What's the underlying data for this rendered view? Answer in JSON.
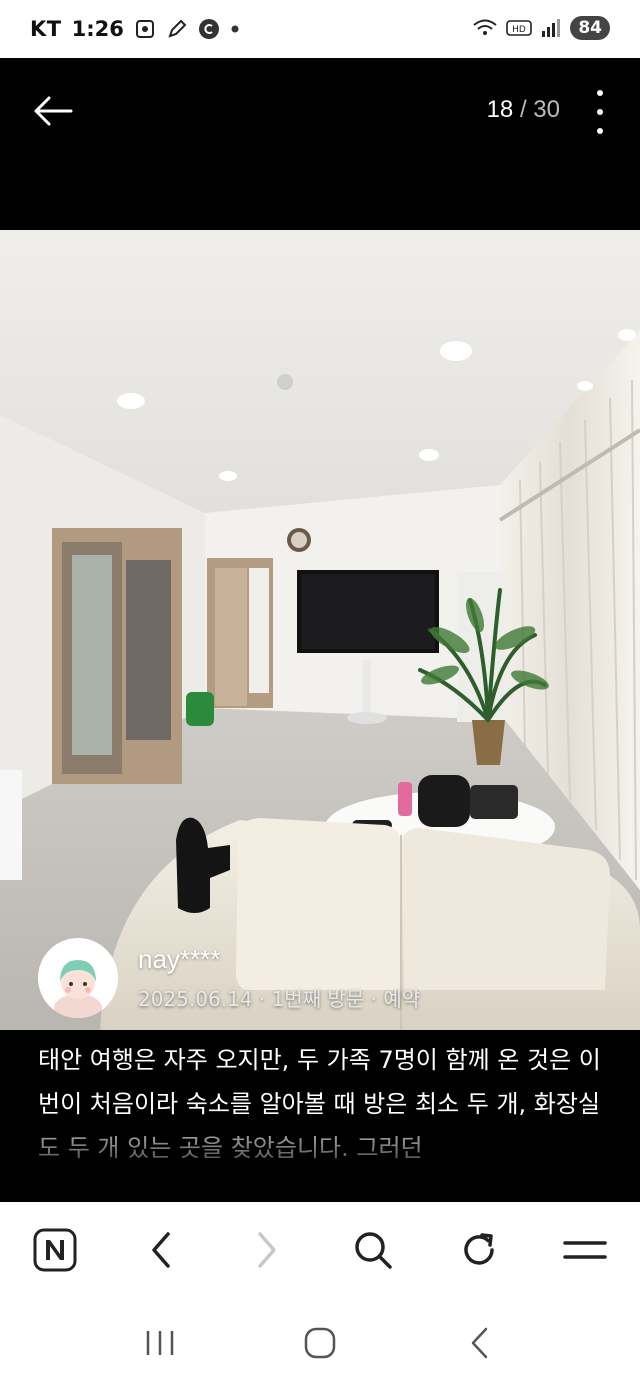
{
  "status_bar": {
    "carrier": "KT",
    "time": "1:26",
    "battery": "84",
    "hd_label": "HD"
  },
  "viewer": {
    "current": "18",
    "separator": "/",
    "total": "30"
  },
  "review": {
    "username": "nay****",
    "meta": "2025.06.14 · 1번째 방문 · 예약",
    "text": "태안 여행은 자주 오지만, 두 가족 7명이 함께 온 것은 이번이 처음이라 숙소를 알아볼 때 방은 최소 두 개, 화장실도 두 개 있는 곳을 찾았습니다. 그러던"
  },
  "browser_toolbar": {
    "items": [
      "naver-home-icon",
      "back-arrow-icon",
      "forward-arrow-icon",
      "search-icon",
      "refresh-icon",
      "menu-icon"
    ]
  },
  "android_nav": {
    "items": [
      "recent-apps-icon",
      "home-icon",
      "back-icon"
    ]
  },
  "colors": {
    "background": "#000000",
    "toolbar_bg": "#ffffff",
    "text_primary": "#ffffff",
    "icon_dark": "#222222",
    "icon_disabled": "#c8c8c8"
  }
}
